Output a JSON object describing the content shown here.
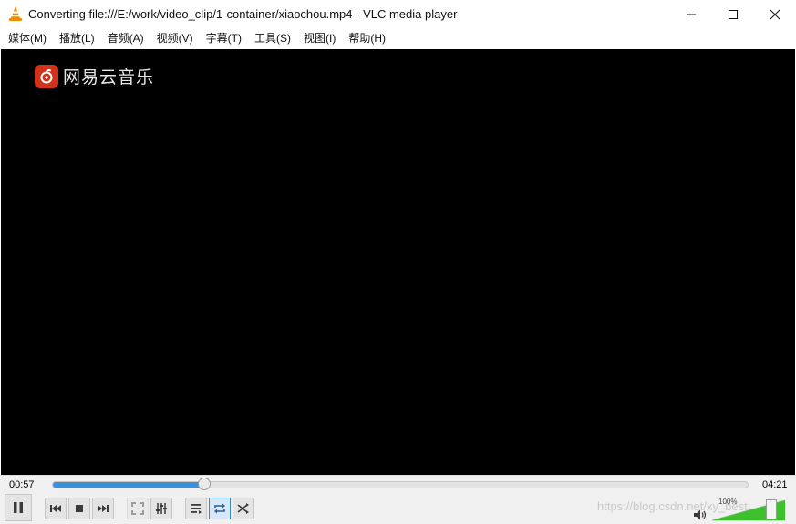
{
  "window": {
    "title": "Converting file:///E:/work/video_clip/1-container/xiaochou.mp4 - VLC media player"
  },
  "menu": {
    "items": [
      "媒体(M)",
      "播放(L)",
      "音频(A)",
      "视频(V)",
      "字幕(T)",
      "工具(S)",
      "视图(I)",
      "帮助(H)"
    ]
  },
  "video": {
    "watermark_text": "网易云音乐"
  },
  "playback": {
    "elapsed": "00:57",
    "total": "04:21",
    "progress": 0.218
  },
  "volume": {
    "label": "100%",
    "level": 1.0
  },
  "overlay": {
    "url_text": "https://blog.csdn.net/xy_best"
  },
  "colors": {
    "accent": "#3e8fd8",
    "volume_green": "#3dc22e",
    "logo_red": "#d0321c",
    "video_bg": "#000000"
  },
  "icons": {
    "app": "vlc-cone-icon",
    "pause": "pause-icon",
    "previous": "skip-previous-icon",
    "stop": "stop-icon",
    "next": "skip-next-icon",
    "fullscreen": "fullscreen-icon",
    "extended": "equalizer-sliders-icon",
    "playlist": "playlist-icon",
    "loop": "loop-icon",
    "shuffle": "shuffle-icon",
    "speaker": "speaker-icon"
  }
}
